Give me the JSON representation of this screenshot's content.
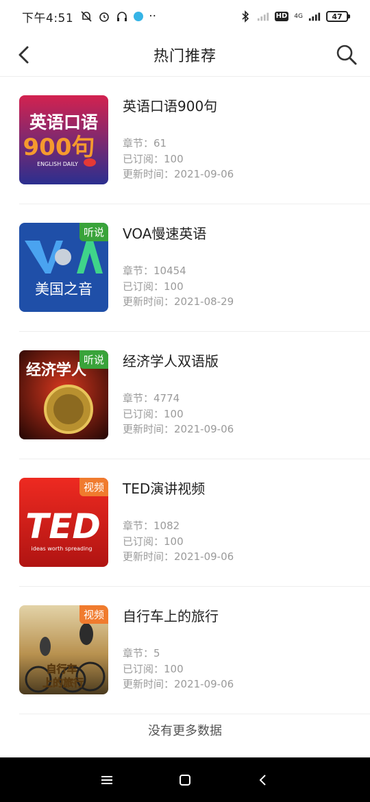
{
  "status_bar": {
    "time": "下午4:51",
    "network": "4G",
    "hd": "HD",
    "battery": "47"
  },
  "header": {
    "title": "热门推荐"
  },
  "items": [
    {
      "title": "英语口语900句",
      "chapters": "章节：61",
      "subscribed": "已订阅：100",
      "updated": "更新时间：2021-09-06",
      "tag": "",
      "cover": {
        "line1": "英语口语",
        "line2": "900句",
        "line3": "ENGLISH DAILY",
        "bg1": "#d3224f",
        "bg2": "#2b2f8f"
      }
    },
    {
      "title": "VOA慢速英语",
      "chapters": "章节：10454",
      "subscribed": "已订阅：100",
      "updated": "更新时间：2021-08-29",
      "tag": "听说",
      "tag_color": "green",
      "cover": {
        "line1": "VOA",
        "line2": "美国之音",
        "bg1": "#1f4fa8",
        "bg2": "#173f8c"
      }
    },
    {
      "title": "经济学人双语版",
      "chapters": "章节：4774",
      "subscribed": "已订阅：100",
      "updated": "更新时间：2021-09-06",
      "tag": "听说",
      "tag_color": "green",
      "cover": {
        "line1": "经济学人",
        "bg1": "#9b1d12",
        "bg2": "#2c0905"
      }
    },
    {
      "title": "TED演讲视频",
      "chapters": "章节：1082",
      "subscribed": "已订阅：100",
      "updated": "更新时间：2021-09-06",
      "tag": "视频",
      "tag_color": "orange",
      "cover": {
        "line1": "TED",
        "line2": "ideas worth spreading",
        "bg1": "#e8251f",
        "bg2": "#b01412"
      }
    },
    {
      "title": "自行车上的旅行",
      "chapters": "章节：5",
      "subscribed": "已订阅：100",
      "updated": "更新时间：2021-09-06",
      "tag": "视频",
      "tag_color": "orange",
      "cover": {
        "line1": "自行车",
        "line2": "上的旅行",
        "bg1": "#c9a76a",
        "bg2": "#5a4a2a"
      }
    }
  ],
  "footer": {
    "no_more": "没有更多数据"
  },
  "icons": {
    "back": "chevron-left-icon",
    "search": "search-icon",
    "menu": "menu-icon",
    "home": "home-icon",
    "sys_back": "back-icon"
  }
}
